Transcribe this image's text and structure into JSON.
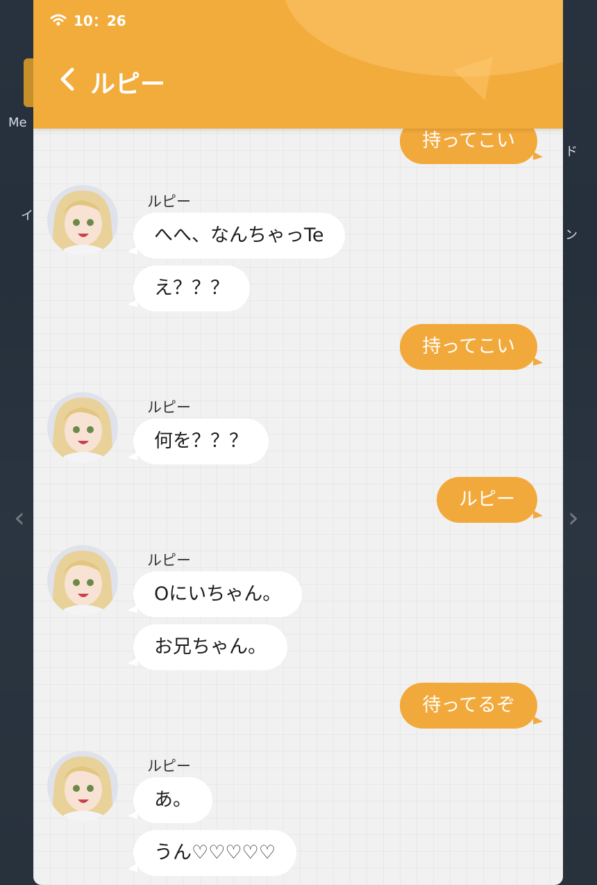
{
  "status_bar": {
    "time": "10：26"
  },
  "header": {
    "title": "ルピー"
  },
  "background": {
    "left_fragment_1": "Me",
    "left_fragment_2": "イ",
    "right_fragment_1": "ド",
    "right_fragment_2": "ン"
  },
  "colors": {
    "header": "#f2ac3c",
    "outgoing_bubble": "#f2a93b",
    "incoming_bubble": "#ffffff",
    "chat_bg": "#f1f1f1"
  },
  "contact": {
    "name": "ルピー",
    "avatar_icon": "avatar-blonde-girl-icon"
  },
  "messages": [
    {
      "from": "me",
      "text": "持ってこい"
    },
    {
      "from": "contact",
      "sender": "ルピー",
      "texts": [
        "へへ、なんちゃっTe",
        "え？？？"
      ]
    },
    {
      "from": "me",
      "text": "持ってこい"
    },
    {
      "from": "contact",
      "sender": "ルピー",
      "texts": [
        "何を？？？"
      ]
    },
    {
      "from": "me",
      "text": "ルピー"
    },
    {
      "from": "contact",
      "sender": "ルピー",
      "texts": [
        "Oにいちゃん。",
        "お兄ちゃん。"
      ]
    },
    {
      "from": "me",
      "text": "待ってるぞ"
    },
    {
      "from": "contact",
      "sender": "ルピー",
      "texts": [
        "あ。",
        "うん♡♡♡♡♡"
      ]
    }
  ]
}
